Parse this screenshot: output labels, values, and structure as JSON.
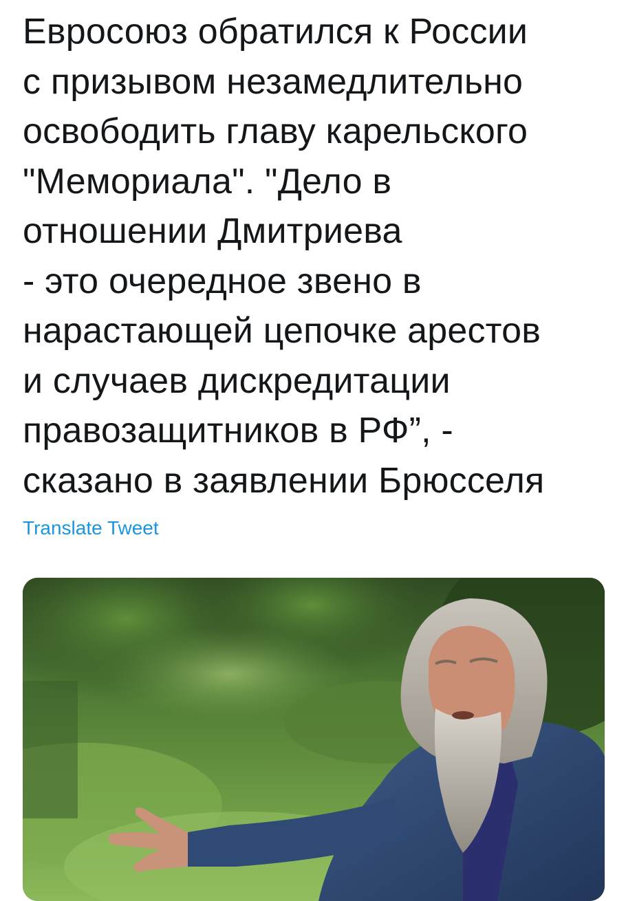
{
  "tweet": {
    "text": "Евросоюз обратился к России\nс призывом незамедлительно\nосвободить главу карельского\n\"Мемориала\". \"Дело в\nотношении Дмитриева\n- это очередное звено в\nнарастающей цепочке арестов\nи случаев дискредитации\nправозащитников в РФ”, -\nсказано в заявлении Брюсселя",
    "translate_label": "Translate Tweet"
  },
  "media": {
    "kind": "photo"
  },
  "colors": {
    "text": "#14171a",
    "link": "#1b95e0",
    "background": "#ffffff"
  }
}
